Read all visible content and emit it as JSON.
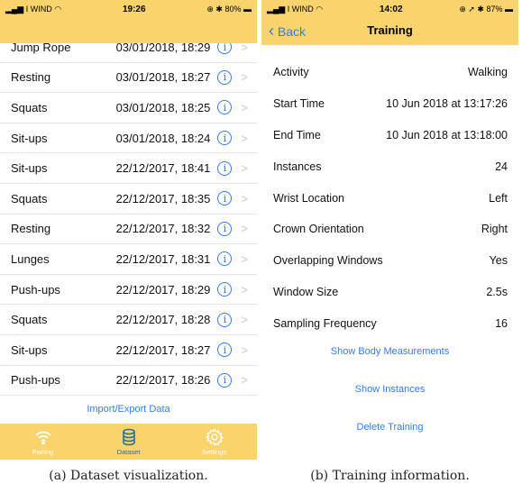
{
  "left": {
    "status": {
      "carrier": "I WIND",
      "time": "19:26",
      "battery": "80%"
    },
    "rows": [
      {
        "name": "Jump Rope",
        "date": "03/01/2018, 18:29"
      },
      {
        "name": "Resting",
        "date": "03/01/2018, 18:27"
      },
      {
        "name": "Squats",
        "date": "03/01/2018, 18:25"
      },
      {
        "name": "Sit-ups",
        "date": "03/01/2018, 18:24"
      },
      {
        "name": "Sit-ups",
        "date": "22/12/2017, 18:41"
      },
      {
        "name": "Squats",
        "date": "22/12/2017, 18:35"
      },
      {
        "name": "Resting",
        "date": "22/12/2017, 18:32"
      },
      {
        "name": "Lunges",
        "date": "22/12/2017, 18:31"
      },
      {
        "name": "Push-ups",
        "date": "22/12/2017, 18:29"
      },
      {
        "name": "Squats",
        "date": "22/12/2017, 18:28"
      },
      {
        "name": "Sit-ups",
        "date": "22/12/2017, 18:27"
      },
      {
        "name": "Push-ups",
        "date": "22/12/2017, 18:26"
      }
    ],
    "import_export": "Import/Export Data",
    "tabs": [
      {
        "label": "Pairing",
        "icon": "wifi-icon"
      },
      {
        "label": "Dataset",
        "icon": "database-icon",
        "active": true
      },
      {
        "label": "Settings",
        "icon": "gear-icon"
      }
    ],
    "caption": "(a) Dataset visualization."
  },
  "right": {
    "status": {
      "carrier": "I WIND",
      "time": "14:02",
      "battery": "87%"
    },
    "back": "Back",
    "title": "Training",
    "fields": [
      {
        "label": "Activity",
        "value": "Walking"
      },
      {
        "label": "Start Time",
        "value": "10 Jun 2018 at 13:17:26"
      },
      {
        "label": "End Time",
        "value": "10 Jun 2018 at 13:18:00"
      },
      {
        "label": "Instances",
        "value": "24"
      },
      {
        "label": "Wrist Location",
        "value": "Left"
      },
      {
        "label": "Crown Orientation",
        "value": "Right"
      },
      {
        "label": "Overlapping Windows",
        "value": "Yes"
      },
      {
        "label": "Window Size",
        "value": "2.5s"
      },
      {
        "label": "Sampling Frequency",
        "value": "16"
      }
    ],
    "show_body": "Show Body Measurements",
    "show_instances": "Show Instances",
    "delete": "Delete Training",
    "caption": "(b) Training information."
  },
  "colors": {
    "bar": "#f9d36b",
    "accent": "#2f7cf6"
  }
}
